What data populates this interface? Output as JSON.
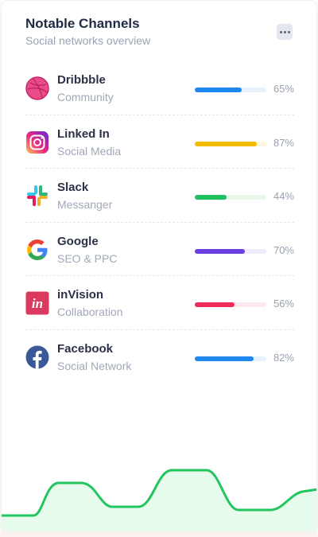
{
  "card": {
    "title": "Notable Channels",
    "subtitle": "Social networks overview",
    "menu_icon": "more-dots-icon"
  },
  "channels": [
    {
      "name": "Dribbble",
      "category": "Community",
      "percent_label": "65%",
      "value": 0.65,
      "icon": "dribbble-icon",
      "bar_color": "#1e88f0",
      "track_color": "#e8f2fd"
    },
    {
      "name": "Linked In",
      "category": "Social Media",
      "percent_label": "87%",
      "value": 0.87,
      "icon": "instagram-icon",
      "bar_color": "#f1bc00",
      "track_color": "#fdf6dd"
    },
    {
      "name": "Slack",
      "category": "Messanger",
      "percent_label": "44%",
      "value": 0.44,
      "icon": "slack-icon",
      "bar_color": "#20c05c",
      "track_color": "#e6f9ec"
    },
    {
      "name": "Google",
      "category": "SEO & PPC",
      "percent_label": "70%",
      "value": 0.7,
      "icon": "google-icon",
      "bar_color": "#6d3fe0",
      "track_color": "#efeafc"
    },
    {
      "name": "inVision",
      "category": "Collaboration",
      "percent_label": "56%",
      "value": 0.56,
      "icon": "invision-icon",
      "bar_color": "#ef2c5a",
      "track_color": "#fde9ee"
    },
    {
      "name": "Facebook",
      "category": "Social Network",
      "percent_label": "82%",
      "value": 0.82,
      "icon": "facebook-icon",
      "bar_color": "#1e88f0",
      "track_color": "#e8f2fd"
    }
  ],
  "wave": {
    "stroke_color": "#22c55e",
    "fill_color": "#e6fbec"
  }
}
